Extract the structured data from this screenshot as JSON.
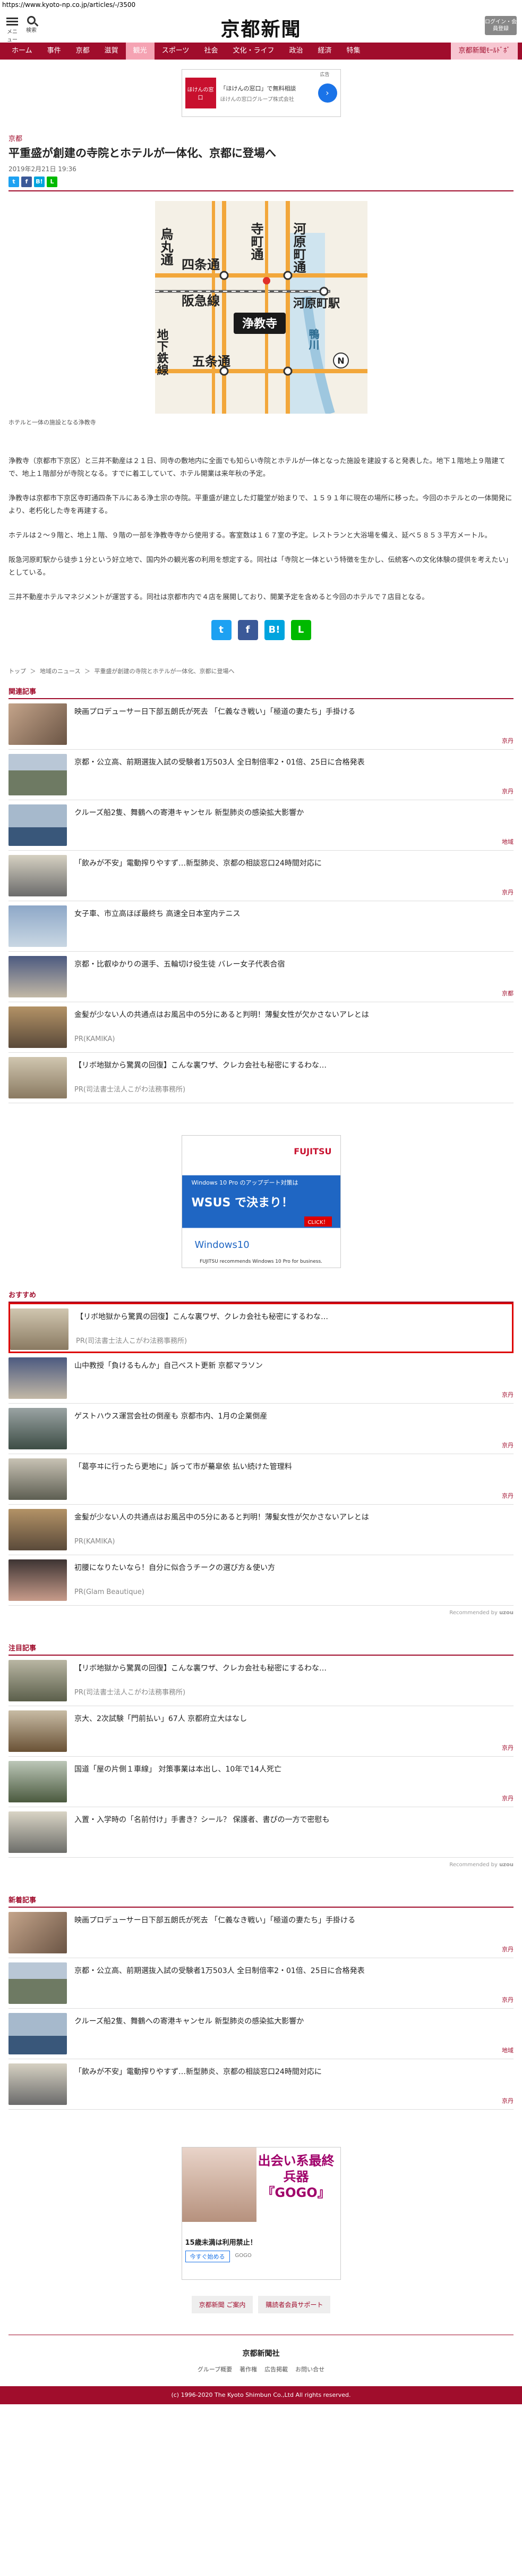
{
  "url": "https://www.kyoto-np.co.jp/articles/-/3500",
  "header": {
    "menu_label": "メニュー",
    "search_label": "検索",
    "logo": "京都新聞",
    "login_label": "ログイン・会員登録"
  },
  "nav": [
    "ホーム",
    "事件",
    "京都",
    "滋賀",
    "観光",
    "スポーツ",
    "社会",
    "文化・ライフ",
    "政治",
    "経済",
    "特集"
  ],
  "nav_members": "京都新聞ﾓｰﾙﾄﾞﾎﾞ",
  "ad_top": {
    "logo_text": "ほけんの窓口",
    "line1": "「ほけんの窓口」で無料相談",
    "line2": "ほけんの窓口グループ株式会社",
    "label": "広告",
    "go_icon": "arrow-right-icon"
  },
  "article": {
    "section": "京都",
    "title": "平重盛が創建の寺院とホテルが一体化、京都に登場へ",
    "date": "2019年2月21日 19:36",
    "caption": "ホテルと一体の施設となる浄教寺",
    "map": {
      "labels": [
        "烏丸通",
        "寺町通",
        "河原町通",
        "四条通",
        "阪急線",
        "河原町駅",
        "浄教寺",
        "地下鉄線",
        "五条通",
        "鴨川",
        "N"
      ]
    },
    "paragraphs": [
      "浄教寺（京都市下京区）と三井不動産は２１日、同寺の敷地内に全面でも知らい寺院とホテルが一体となった施設を建設すると発表した。地下１階地上９階建てで、地上１階部分が寺院となる。すでに着工していて、ホテル開業は来年秋の予定。",
      "浄教寺は京都市下京区寺町通四条下ルにある浄土宗の寺院。平重盛が建立した灯籠堂が始まりで、１５９１年に現在の場所に移った。今回のホテルとの一体開発により、老朽化した寺を再建する。",
      "ホテルは２～９階と、地上１階、９階の一部を浄教寺寺から使用する。客室数は１６７室の予定。レストランと大浴場を備え、延べ５８５３平方メートル。",
      "阪急河原町駅から徒歩１分という好立地で、国内外の観光客の利用を想定する。同社は「寺院と一体という特徴を生かし、伝統客への文化体験の提供を考えたい」としている。",
      "三井不動産ホテルマネジメントが運営する。同社は京都市内で４店を展開しており、開業予定を含めると今回のホテルで７店目となる。"
    ]
  },
  "share": {
    "twitter": "t",
    "facebook": "f",
    "hatena": "B!",
    "line": "L"
  },
  "breadcrumbs": [
    "トップ",
    "＞",
    "地域のニュース",
    "＞",
    "平重盛が創建の寺院とホテルが一体化、京都に登場へ"
  ],
  "related": {
    "title": "関連記事",
    "items": [
      {
        "text": "映画プロデューサー日下部五朗氏が死去 「仁義なき戦い」「極道の妻たち」手掛ける",
        "tag": "京丹",
        "thumb": "thumb-man"
      },
      {
        "text": "京都・公立高、前期選抜入試の受験者1万503人 全日制倍率2・01倍、25日に合格発表",
        "tag": "京丹",
        "thumb": "thumb-build"
      },
      {
        "text": "クルーズ船2隻、舞鶴への寄港キャンセル 新型肺炎の感染拡大影響か",
        "tag": "地域",
        "thumb": "thumb-ship"
      },
      {
        "text": "「飲みが不安」電動搾りやすず…新型肺炎、京都の相談窓口24時間対応に",
        "tag": "京丹",
        "thumb": "thumb-train"
      },
      {
        "text": "女子車、市立高ほぼ最終ち 高速全日本室内テニス",
        "tag": "",
        "thumb": "thumb-ten"
      },
      {
        "text": "京都・比叡ゆかりの選手、五輪切け役生徒 バレー女子代表合宿",
        "tag": "京都",
        "thumb": "thumb-run"
      },
      {
        "text": "金髪が少ない人の共通点はお風呂中の5分にあると判明！薄髪女性が欠かさないアレとは",
        "pr": "PR(KAMIKA)",
        "thumb": "thumb-coin"
      },
      {
        "text": "【リボ地獄から驚異の回復】こんな裏ワザ、クレカ会社も秘密にするわな…",
        "pr": "PR(司法書士法人こがわ法務事務所)",
        "thumb": "thumb-cash"
      }
    ]
  },
  "ad_mid": {
    "brand": "FUJITSU",
    "line1": "Windows 10 Pro のアップデート対策は",
    "big": "WSUS で決まり！",
    "cta": "CLICK！",
    "windows": "Windows10",
    "small": "FUJITSU recommends Windows 10 Pro for business."
  },
  "recommend": {
    "title": "おすすめ",
    "credit": "Recommended by",
    "credit_brand": "uzou",
    "items": [
      {
        "text": "【リボ地獄から驚異の回復】こんな裏ワザ、クレカ会社も秘密にするわな…",
        "pr": "PR(司法書士法人こがわ法務事務所)",
        "thumb": "thumb-cash",
        "hl": true
      },
      {
        "text": "山中教授「負けるもんか」自己ベスト更新 京都マラソン",
        "tag": "京丹",
        "thumb": "thumb-run"
      },
      {
        "text": "ゲストハウス運営会社の倒産も 京都市内、1月の企業倒産",
        "tag": "京丹",
        "thumb": "thumb-guest"
      },
      {
        "text": "「葛亭ヰに行ったら更地に」訴って市が驀皐依 払い続けた管理料",
        "tag": "京丹",
        "thumb": "thumb-house"
      },
      {
        "text": "金髪が少ない人の共通点はお風呂中の5分にあると判明！薄髪女性が欠かさないアレとは",
        "pr": "PR(KAMIKA)",
        "thumb": "thumb-coin"
      },
      {
        "text": "初腰になりたいなら！自分に似合うチークの選び方＆使い方",
        "pr": "PR(Glam Beautique)",
        "thumb": "thumb-woman"
      }
    ]
  },
  "popular": {
    "title": "注目記事",
    "credit": "Recommended by",
    "credit_brand": "uzou",
    "items": [
      {
        "text": "【リボ地獄から驚異の回復】こんな裏ワザ、クレカ会社も秘密にするわな…",
        "pr": "PR(司法書士法人こがわ法務事務所)",
        "thumb": "thumb-notes"
      },
      {
        "text": "京大、2次試験「門前払い」67人 京都府立大はなし",
        "tag": "京丹",
        "thumb": "thumb-temple"
      },
      {
        "text": "国道「屋の片側１車線」 対策事業は本出し、10年で14人死亡",
        "tag": "京丹",
        "thumb": "thumb-shrine"
      },
      {
        "text": "入置・入学時の「名前付け」手書き？シール？ 保護者、書ぴの一方で密慰も",
        "tag": "",
        "thumb": "thumb-wall"
      }
    ]
  },
  "latest": {
    "title": "新着記事",
    "items": [
      {
        "text": "映画プロデューサー日下部五朗氏が死去 「仁義なき戦い」「極道の妻たち」手掛ける",
        "tag": "京丹",
        "thumb": "thumb-man"
      },
      {
        "text": "京都・公立高、前期選抜入試の受験者1万503人 全日制倍率2・01倍、25日に合格発表",
        "tag": "京丹",
        "thumb": "thumb-build"
      },
      {
        "text": "クルーズ船2隻、舞鶴への寄港キャンセル 新型肺炎の感染拡大影響か",
        "tag": "地域",
        "thumb": "thumb-ship"
      },
      {
        "text": "「飲みが不安」電動搾りやすず…新型肺炎、京都の相談窓口24時間対応に",
        "tag": "京丹",
        "thumb": "thumb-train"
      }
    ]
  },
  "ad_bottom": {
    "title": "出会い系最終兵器『GOGO』",
    "line": "15歳未満は利用禁止！",
    "cta": "今すぐ始める",
    "sub": "GOGO"
  },
  "footer": {
    "btn1": "京都新聞 ご案内",
    "btn2": "購読者会員サポート",
    "logo": "京都新聞社",
    "links": [
      "グループ概要",
      "著作権",
      "広告掲載",
      "お問い合せ"
    ],
    "copyright": "(c) 1996-2020 The Kyoto Shimbun Co.,Ltd All rights reserved."
  },
  "colors": {
    "brand": "#a00d2c",
    "twitter": "#1da1f2",
    "facebook": "#3b5998",
    "hatena": "#00a4de",
    "line": "#00b900"
  }
}
